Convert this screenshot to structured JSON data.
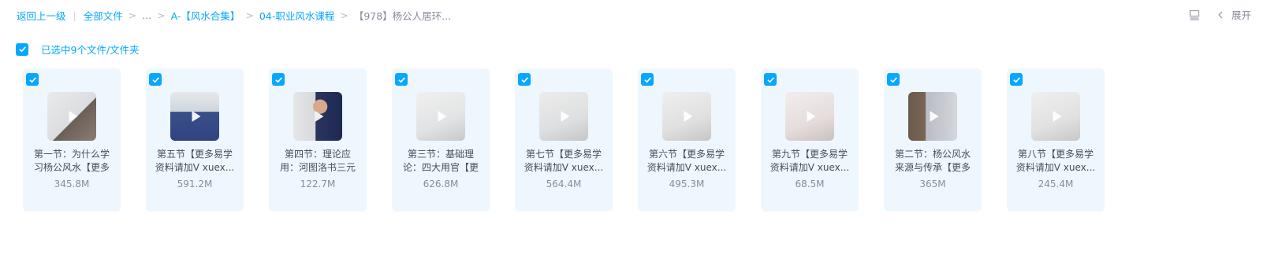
{
  "breadcrumb": {
    "back": "返回上一级",
    "all_files": "全部文件",
    "ellipsis": "...",
    "folder1": "A-【风水合集】",
    "folder2": "04-职业风水课程",
    "current": "【978】杨公人居环..."
  },
  "toolbar": {
    "expand_label": "展开"
  },
  "selection": {
    "text": "已选中9个文件/文件夹"
  },
  "files": [
    {
      "name": "第一节：为什么学习杨公风水【更多",
      "size": "345.8M",
      "thumb": "whiteboard-banner"
    },
    {
      "name": "第五节【更多易学资料请加V xuex...",
      "size": "591.2M",
      "thumb": "person-blue"
    },
    {
      "name": "第四节：理论应用：河图洛书三元",
      "size": "122.7M",
      "thumb": "person-lecture"
    },
    {
      "name": "第三节：基础理论：四大用官【更",
      "size": "626.8M",
      "thumb": "whiteboard"
    },
    {
      "name": "第七节【更多易学资料请加V xuex...",
      "size": "564.4M",
      "thumb": "whiteboard-diagram"
    },
    {
      "name": "第六节【更多易学资料请加V xuex...",
      "size": "495.3M",
      "thumb": "whiteboard-writing"
    },
    {
      "name": "第九节【更多易学资料请加V xuex...",
      "size": "68.5M",
      "thumb": "whiteboard-red"
    },
    {
      "name": "第二节：杨公风水来源与传承【更多",
      "size": "365M",
      "thumb": "sparkle-screen"
    },
    {
      "name": "第八节【更多易学资料请加V xuex...",
      "size": "245.4M",
      "thumb": "whiteboard-circle"
    }
  ]
}
